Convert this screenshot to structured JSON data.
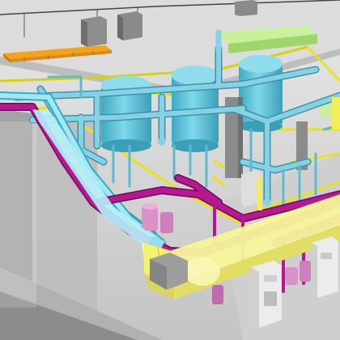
{
  "scene": {
    "kind": "bim-mep-3d-model-render",
    "colors": {
      "background_light": "#f2f2f2",
      "floor_gray": "#c9c9c9",
      "wall_gray": "#9f9f9f",
      "slab_edge": "#7a7a7a",
      "water_pipe_cyan": "#7fd0e3",
      "water_pipe_shade": "#4aa6bd",
      "tank_blue": "#63c7db",
      "duct_yellow": "#f3f36b",
      "duct_yellow_edge": "#c9c930",
      "rail_yellow": "#f7e41d",
      "pallet_orange": "#f3a31b",
      "magenta_pipe": "#b0178f",
      "magenta_shade": "#7e0f67",
      "pump_pink": "#d58ac6",
      "green_duct": "#c8f29a",
      "cabinet_gray": "#dadada"
    },
    "icons": [
      "storage-tank-icon",
      "pipe-icon",
      "duct-icon",
      "pump-icon",
      "cabinet-icon"
    ]
  }
}
